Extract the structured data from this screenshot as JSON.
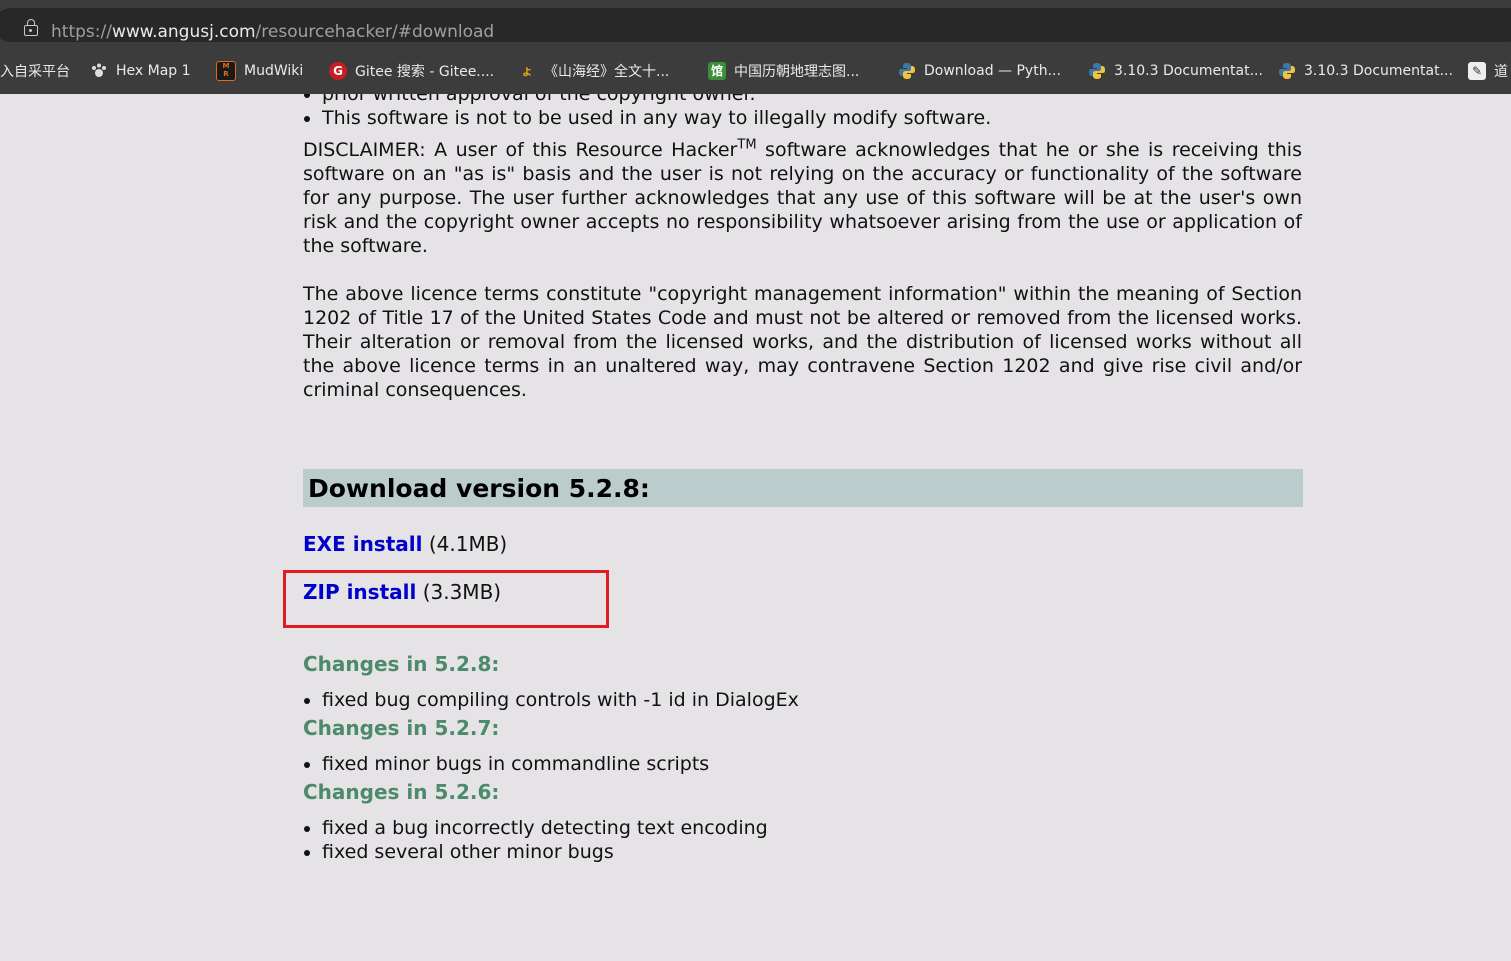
{
  "browser": {
    "url_prefix": "https://",
    "url_host": "www.angusj.com",
    "url_path": "/resourcehacker/#download",
    "bookmarks": [
      {
        "label": "入自采平台",
        "icon": "none"
      },
      {
        "label": "Hex Map 1",
        "icon": "paw-icon"
      },
      {
        "label": "MudWiki",
        "icon": "mud-icon"
      },
      {
        "label": "Gitee 搜索 - Gitee....",
        "icon": "gitee-icon"
      },
      {
        "label": "《山海经》全文十...",
        "icon": "book-icon"
      },
      {
        "label": "中国历朝地理志图...",
        "icon": "library-icon"
      },
      {
        "label": "Download — Pyth...",
        "icon": "python-icon"
      },
      {
        "label": "3.10.3 Documentat...",
        "icon": "python-icon"
      },
      {
        "label": "3.10.3 Documentat...",
        "icon": "python-icon"
      },
      {
        "label": "道",
        "icon": "site-icon"
      }
    ]
  },
  "license": {
    "clipped_bullet": "prior written approval of the copyright owner.",
    "bullet_last": "This software is not to be used in any way to illegally modify software.",
    "disclaimer_pre": "DISCLAIMER: A user of this Resource Hacker",
    "disclaimer_tm": "TM",
    "disclaimer_post": " software acknowledges that he or she is receiving this software on an \"as is\" basis and the user is not relying on the accuracy or functionality of the software for any purpose. The user further acknowledges that any use of this software will be at the user's own risk and the copyright owner accepts no responsibility whatsoever arising from the use or application of the software.",
    "copyright_para": "The above licence terms constitute \"copyright management information\" within the meaning of Section 1202 of Title 17 of the United States Code and must not be altered or removed from the licensed works. Their alteration or removal from the licensed works, and the distribution of licensed works without all the above licence terms in an unaltered way, may contravene Section 1202 and give rise civil and/or criminal consequences."
  },
  "download": {
    "heading": "Download version 5.2.8:",
    "exe_label": "EXE install",
    "exe_size": " (4.1MB)",
    "zip_label": "ZIP install",
    "zip_size": " (3.3MB)"
  },
  "changes": [
    {
      "title": "Changes in 5.2.8:",
      "items": [
        "fixed bug compiling controls with -1 id in DialogEx"
      ]
    },
    {
      "title": "Changes in 5.2.7:",
      "items": [
        "fixed minor bugs in commandline scripts"
      ]
    },
    {
      "title": "Changes in 5.2.6:",
      "items": [
        "fixed a bug incorrectly detecting text encoding",
        "fixed several other minor bugs"
      ]
    }
  ],
  "colors": {
    "link": "#0000cc",
    "changes_title": "#4b8a6a",
    "download_header_bg": "#bacccb",
    "highlight_box": "#e01b24"
  }
}
